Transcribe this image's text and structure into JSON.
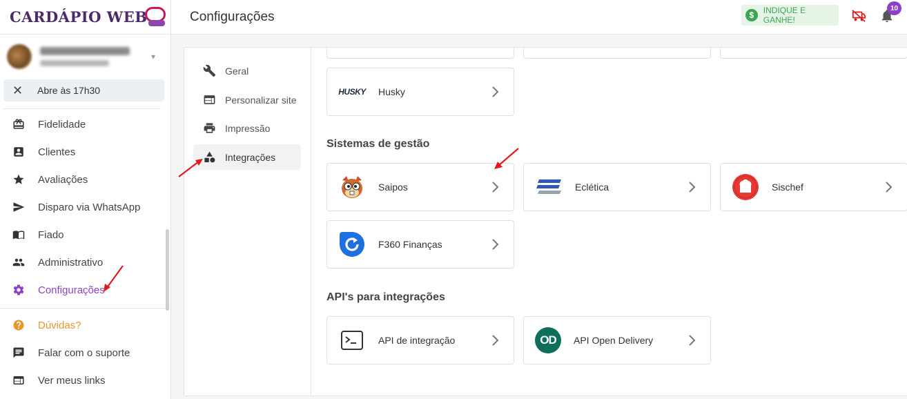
{
  "brand": {
    "logo_text": "CARDÁPIO WEB"
  },
  "store": {
    "name": "Loja Doce Burgueira",
    "subtitle": "Fechado · Configurar"
  },
  "status": {
    "label": "Abre às 17h30"
  },
  "sidebar": {
    "items": [
      {
        "label": "Fidelidade",
        "icon": "gift-icon"
      },
      {
        "label": "Clientes",
        "icon": "account-box-icon"
      },
      {
        "label": "Avaliações",
        "icon": "star-icon"
      },
      {
        "label": "Disparo via WhatsApp",
        "icon": "send-icon"
      },
      {
        "label": "Fiado",
        "icon": "book-icon"
      },
      {
        "label": "Administrativo",
        "icon": "people-icon"
      },
      {
        "label": "Configurações",
        "icon": "gear-icon",
        "active": true
      }
    ],
    "footer": [
      {
        "label": "Dúvidas?",
        "icon": "help-icon"
      },
      {
        "label": "Falar com o suporte",
        "icon": "chat-icon"
      },
      {
        "label": "Ver meus links",
        "icon": "web-icon"
      }
    ]
  },
  "header": {
    "title": "Configurações",
    "referral_label": "INDIQUE E GANHE!",
    "notifications_count": "10"
  },
  "settings_nav": [
    {
      "label": "Geral",
      "icon": "wrench-icon"
    },
    {
      "label": "Personalizar site",
      "icon": "web-layout-icon"
    },
    {
      "label": "Impressão",
      "icon": "printer-icon"
    },
    {
      "label": "Integrações",
      "icon": "shapes-icon",
      "active": true
    }
  ],
  "integrations": {
    "husky": {
      "name": "Husky",
      "logo_text": "HUSKY"
    },
    "gestao_title": "Sistemas de gestão",
    "gestao": [
      {
        "name": "Saipos",
        "icon": "saipos-logo-icon"
      },
      {
        "name": "Eclética",
        "icon": "ecletica-logo-icon"
      },
      {
        "name": "Sischef",
        "icon": "sischef-logo-icon"
      },
      {
        "name": "F360 Finanças",
        "icon": "f360-logo-icon"
      }
    ],
    "api_title": "API's para integrações",
    "api": [
      {
        "name": "API de integração",
        "icon": "terminal-icon"
      },
      {
        "name": "API Open Delivery",
        "icon": "open-delivery-logo-icon",
        "logo_text": "OD"
      }
    ]
  },
  "colors": {
    "accent": "#8e3fc9",
    "help": "#e6962e",
    "referral": "#3aa654",
    "arrow": "#e0191c"
  }
}
